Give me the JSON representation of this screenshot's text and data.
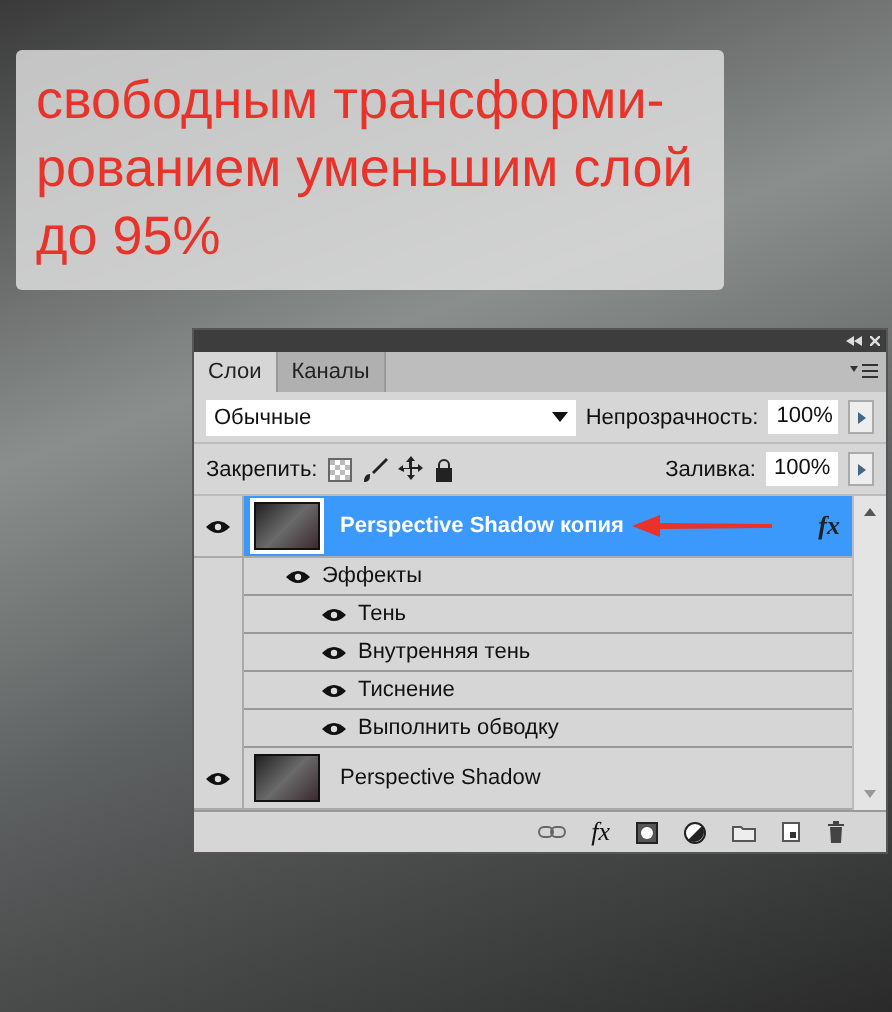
{
  "caption": {
    "lines": [
      "свободным трансформи-",
      "рованием уменьшим слой",
      "до 95%"
    ]
  },
  "panel": {
    "tabs": [
      {
        "label": "Слои",
        "selected": true
      },
      {
        "label": "Каналы",
        "selected": false
      }
    ],
    "blend_mode": "Обычные",
    "opacity_label": "Непрозрачность:",
    "opacity": "100%",
    "lock_label": "Закрепить:",
    "fill_label": "Заливка:",
    "fill": "100%",
    "layers": [
      {
        "name": "Perspective Shadow копия",
        "selected": true,
        "visible": true,
        "fx": "fx",
        "arrow": true,
        "effects": {
          "name": "Эффекты",
          "visible": true,
          "children": [
            {
              "name": "Тень",
              "visible": true
            },
            {
              "name": "Внутренняя тень",
              "visible": true
            },
            {
              "name": "Тиснение",
              "visible": true
            },
            {
              "name": "Выполнить обводку",
              "visible": true
            }
          ]
        }
      },
      {
        "name": "Perspective Shadow",
        "selected": false,
        "visible": true,
        "arrow": false
      }
    ],
    "footer_fx": "fx"
  }
}
